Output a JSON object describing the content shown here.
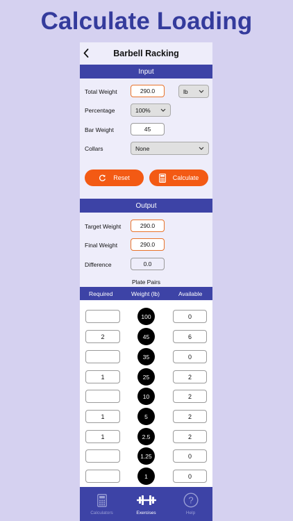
{
  "hero_title": "Calculate Loading",
  "nav": {
    "title": "Barbell Racking"
  },
  "input_section": {
    "title": "Input",
    "total_weight": {
      "label": "Total Weight",
      "value": "290.0",
      "unit": "lb"
    },
    "percentage": {
      "label": "Percentage",
      "value": "100%"
    },
    "bar_weight": {
      "label": "Bar Weight",
      "value": "45"
    },
    "collars": {
      "label": "Collars",
      "value": "None"
    },
    "reset_label": "Reset",
    "calculate_label": "Calculate"
  },
  "output_section": {
    "title": "Output",
    "target_weight": {
      "label": "Target Weight",
      "value": "290.0"
    },
    "final_weight": {
      "label": "Final Weight",
      "value": "290.0"
    },
    "difference": {
      "label": "Difference",
      "value": "0.0"
    }
  },
  "plate_pairs": {
    "title": "Plate Pairs",
    "columns": [
      "Required",
      "Weight (lb)",
      "Available"
    ],
    "rows": [
      {
        "required": "",
        "weight": "100",
        "available": "0"
      },
      {
        "required": "2",
        "weight": "45",
        "available": "6"
      },
      {
        "required": "",
        "weight": "35",
        "available": "0"
      },
      {
        "required": "1",
        "weight": "25",
        "available": "2"
      },
      {
        "required": "",
        "weight": "10",
        "available": "2"
      },
      {
        "required": "1",
        "weight": "5",
        "available": "2"
      },
      {
        "required": "1",
        "weight": "2.5",
        "available": "2"
      },
      {
        "required": "",
        "weight": "1.25",
        "available": "0"
      },
      {
        "required": "",
        "weight": "1",
        "available": "0"
      }
    ]
  },
  "tabs": [
    {
      "label": "Calculators",
      "icon": "calculator-icon",
      "active": false
    },
    {
      "label": "Exercises",
      "icon": "barbell-icon",
      "active": true
    },
    {
      "label": "Help",
      "icon": "help-icon",
      "active": false
    }
  ],
  "colors": {
    "background": "#d5d1f0",
    "brand": "#3d43a6",
    "accent": "#f35a14",
    "hero_text": "#343b9c"
  }
}
